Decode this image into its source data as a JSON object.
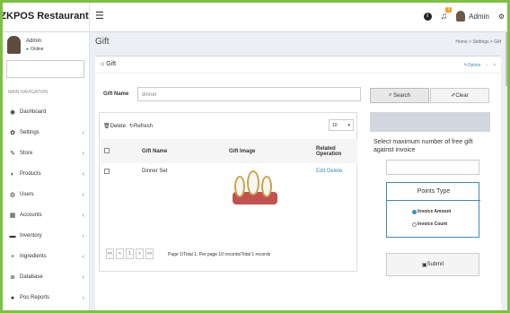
{
  "app": {
    "name": "ZKPOS Restaurant"
  },
  "header": {
    "badge": "3",
    "username": "Admin"
  },
  "sidebar": {
    "user_name": "Admin",
    "user_status": "Online",
    "search_placeholder": "",
    "nav_header": "MAIN NAVIGATION",
    "items": [
      {
        "label": "Dashboard",
        "icon": "dashboard-icon"
      },
      {
        "label": "Settings",
        "icon": "gear-icon"
      },
      {
        "label": "Store",
        "icon": "pin-icon"
      },
      {
        "label": "Products",
        "icon": "products-icon"
      },
      {
        "label": "Users",
        "icon": "user-icon"
      },
      {
        "label": "Accounts",
        "icon": "accounts-icon"
      },
      {
        "label": "Inventory",
        "icon": "truck-icon"
      },
      {
        "label": "Ingredients",
        "icon": "plus-icon"
      },
      {
        "label": "Database",
        "icon": "database-icon"
      },
      {
        "label": "Pos Reports",
        "icon": "reports-icon"
      }
    ]
  },
  "content": {
    "title": "Gift",
    "breadcrumb": "Home > Settings > Gift",
    "box_title": "Gift",
    "options": "Option",
    "gift_name_label": "Gift Name",
    "gift_name_value": "dinner",
    "search_btn": "Search",
    "clear_btn": "Clear",
    "delete": "Delete",
    "refresh": "Refresh",
    "page_size": "10",
    "table": {
      "headers": [
        "",
        "Gift Name",
        "Gift Image",
        "Related Operation"
      ],
      "rows": [
        {
          "name": "Dinner Set",
          "edit": "Edit",
          "delete": "Delete"
        }
      ]
    },
    "pager": {
      "first": "<<",
      "prev": "<",
      "page": "1",
      "next": ">",
      "last": ">>"
    },
    "page_info": "Page 1/Total 1; Per page 10 records/Total 1 records",
    "right": {
      "description": "Select maximum number of free gift against invoice",
      "points_type_title": "Points Type",
      "option1": "Invoice Amount",
      "option2": "Invoice Count",
      "submit": "Submit"
    }
  },
  "colors": {
    "accent": "#3c8dbc",
    "border": "#7ec043",
    "online": "#00a65a"
  }
}
